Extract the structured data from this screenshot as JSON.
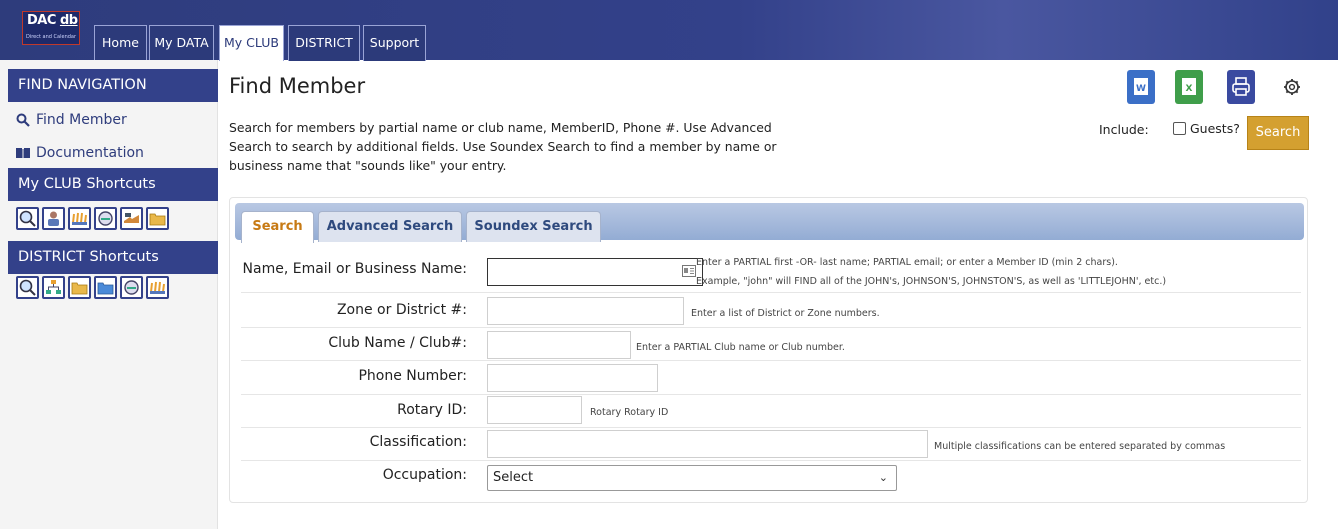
{
  "logo": {
    "line1a": "DAC",
    "line1b": "db",
    "line2": "Direct and Calendar"
  },
  "nav_tabs": [
    "Home",
    "My DATA",
    "My CLUB",
    "DISTRICT",
    "Support"
  ],
  "active_tab": "My CLUB",
  "sidebar": {
    "find_nav": "FIND NAVIGATION",
    "links": [
      {
        "label": "Find Member",
        "icon": "search-icon"
      },
      {
        "label": "Documentation",
        "icon": "book-icon"
      }
    ],
    "club_shortcuts": "My CLUB Shortcuts",
    "district_shortcuts": "DISTRICT Shortcuts",
    "club_icons": [
      "find-icon",
      "members-icon",
      "group-icon",
      "calendar-icon",
      "handshake-icon",
      "folder-icon"
    ],
    "district_icons": [
      "find-icon",
      "organization-icon",
      "folder-icon",
      "folder-open-icon",
      "calendar-icon",
      "group-icon"
    ]
  },
  "page": {
    "title": "Find Member",
    "description": "Search for members by partial name or club name, MemberID, Phone #. Use Advanced Search to search by additional fields. Use Soundex Search to find a member by name or business name that \"sounds like\" your entry.",
    "tools": [
      "word-icon",
      "excel-icon",
      "print-icon",
      "gear-icon"
    ],
    "include_label": "Include:",
    "guests_label": "Guests?",
    "search_button": "Search"
  },
  "search_tabs": [
    "Search",
    "Advanced Search",
    "Soundex Search"
  ],
  "form": {
    "name_label": "Name, Email or Business Name:",
    "name_hint_1": "Enter a PARTIAL first -OR- last name; PARTIAL email; or enter a Member ID (min 2 chars).",
    "name_hint_2": "Example, \"john\" will FIND all of the JOHN's, JOHNSON'S, JOHNSTON'S, as well as 'LITTLEJOHN', etc.)",
    "zone_label": "Zone or District #:",
    "zone_hint": "Enter a list of District or Zone numbers.",
    "club_label": "Club Name / Club#:",
    "club_hint": "Enter a PARTIAL Club name or Club number.",
    "phone_label": "Phone Number:",
    "rotary_label": "Rotary ID:",
    "rotary_hint": "Rotary Rotary ID",
    "class_label": "Classification:",
    "class_hint": "Multiple classifications can be entered separated by commas",
    "occ_label": "Occupation:",
    "occ_value": "Select"
  },
  "colors": {
    "nav": "#33418a",
    "search_button": "#d4a030",
    "active_tab_text": "#c77a14"
  }
}
